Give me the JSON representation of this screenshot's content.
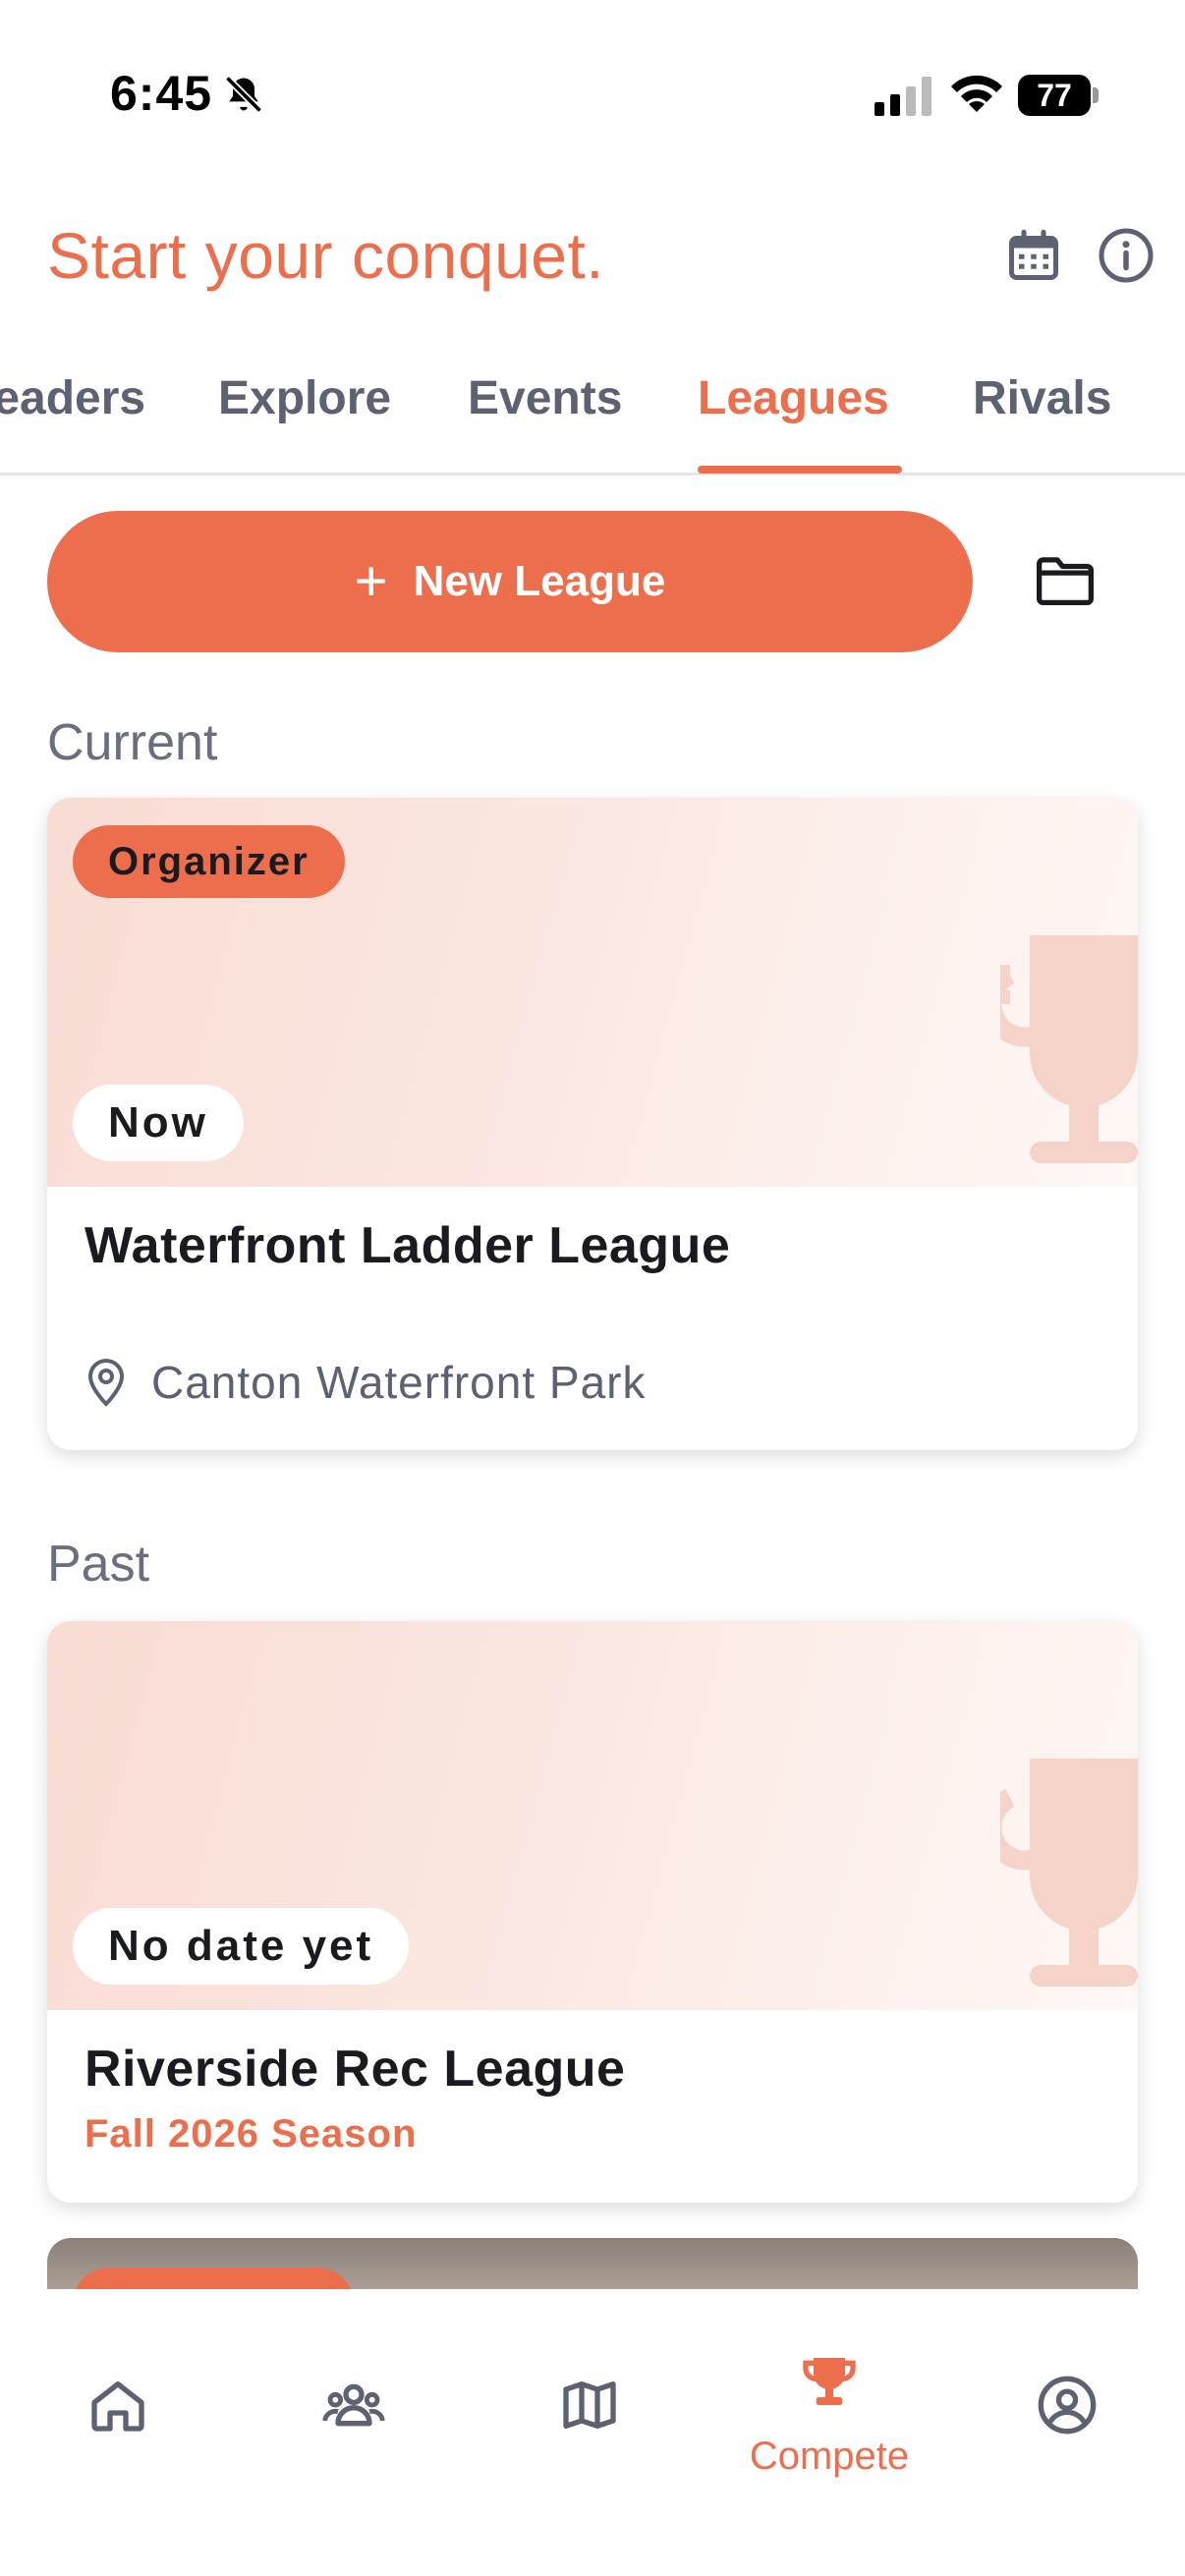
{
  "status_bar": {
    "time": "6:45",
    "battery": "77",
    "icons": [
      "bell-off-icon",
      "signal-icon",
      "wifi-icon",
      "battery-icon"
    ]
  },
  "header": {
    "title": "Start your conquet.",
    "icons": [
      "calendar-icon",
      "info-icon"
    ]
  },
  "tabs": [
    {
      "label": "Leaders"
    },
    {
      "label": "Explore"
    },
    {
      "label": "Events"
    },
    {
      "label": "Leagues"
    },
    {
      "label": "Rivals"
    }
  ],
  "active_tab": "Leagues",
  "actions": {
    "new_league_label": "New League",
    "plus_glyph": "+",
    "folder_icon": "folder-icon"
  },
  "sections": {
    "current": "Current",
    "past": "Past"
  },
  "current_leagues": [
    {
      "role_badge": "Organizer",
      "date_badge": "Now",
      "title": "Waterfront Ladder League",
      "location": "Canton Waterfront Park"
    }
  ],
  "past_leagues": [
    {
      "date_badge": "No date yet",
      "title": "Riverside Rec League",
      "subtitle": "Fall 2026 Season"
    }
  ],
  "bottom_nav": [
    {
      "icon": "home-icon",
      "label": ""
    },
    {
      "icon": "people-icon",
      "label": ""
    },
    {
      "icon": "map-icon",
      "label": ""
    },
    {
      "icon": "trophy-icon",
      "label": "Compete"
    },
    {
      "icon": "profile-icon",
      "label": ""
    }
  ],
  "colors": {
    "accent": "#ec6e4d",
    "text_primary": "#1a1b20",
    "text_secondary": "#5d6273",
    "banner_tint": "#f9dcd4"
  }
}
